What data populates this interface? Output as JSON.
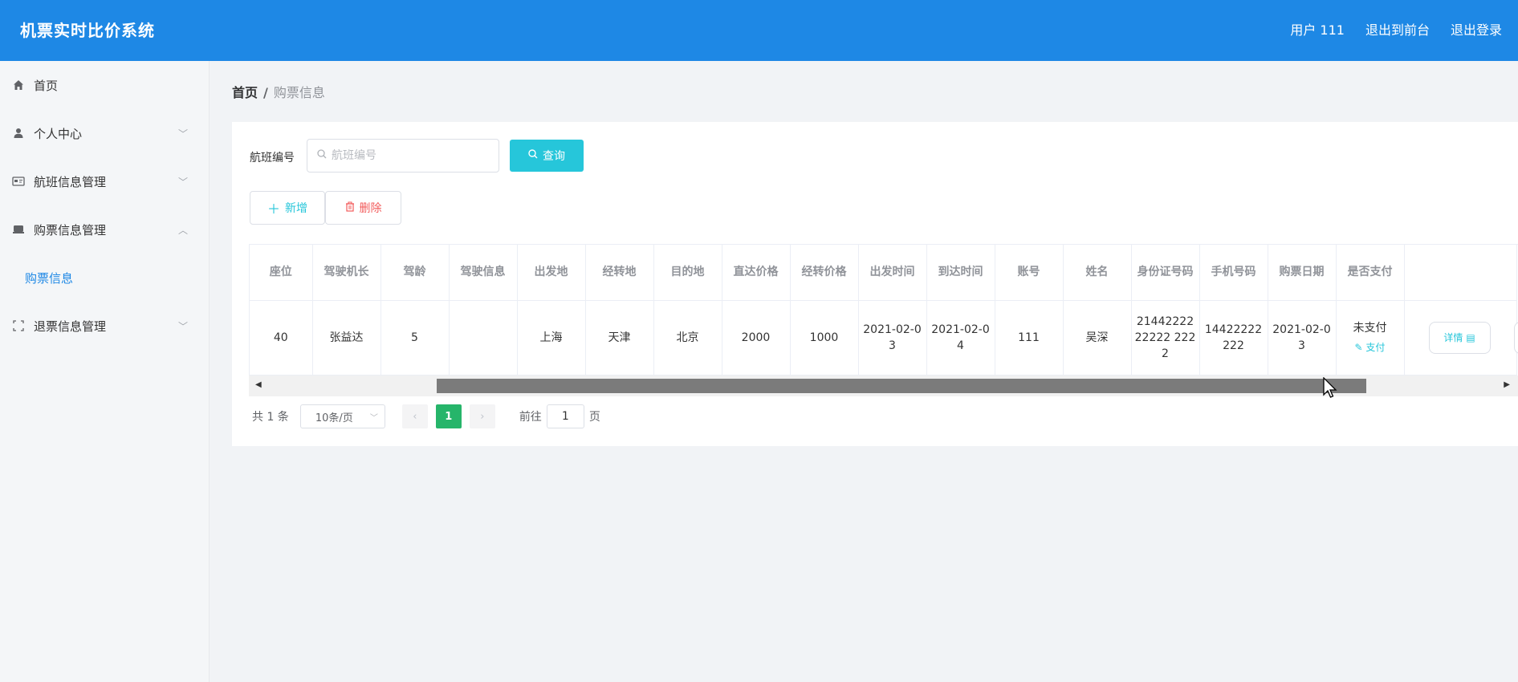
{
  "header": {
    "title": "机票实时比价系统",
    "user": "用户 111",
    "to_front": "退出到前台",
    "logout": "退出登录"
  },
  "sidebar": {
    "items": [
      {
        "label": "首页",
        "icon": "home-icon"
      },
      {
        "label": "个人中心",
        "icon": "user-icon"
      },
      {
        "label": "航班信息管理",
        "icon": "card-icon"
      },
      {
        "label": "购票信息管理",
        "icon": "ticket-icon",
        "expanded": true,
        "children": [
          {
            "label": "购票信息"
          }
        ]
      },
      {
        "label": "退票信息管理",
        "icon": "expand-icon"
      }
    ]
  },
  "breadcrumb": {
    "home": "首页",
    "sep": "/",
    "current": "购票信息"
  },
  "search": {
    "label": "航班编号",
    "placeholder": "航班编号",
    "query_label": "查询"
  },
  "actions": {
    "add_label": "新增",
    "delete_label": "删除"
  },
  "table": {
    "columns": [
      "座位",
      "驾驶机长",
      "驾龄",
      "驾驶信息",
      "出发地",
      "经转地",
      "目的地",
      "直达价格",
      "经转价格",
      "出发时间",
      "到达时间",
      "账号",
      "姓名",
      "身份证号码",
      "手机号码",
      "购票日期",
      "是否支付",
      ""
    ],
    "rows": [
      {
        "cells": [
          "40",
          "张益达",
          "5",
          "",
          "上海",
          "天津",
          "北京",
          "2000",
          "1000",
          "2021-02-03",
          "2021-02-04",
          "111",
          "吴深",
          "2144222222222 2222",
          "14422222222",
          "2021-02-03"
        ],
        "pay_status": "未支付",
        "pay_action": "支付",
        "detail_label": "详情"
      }
    ]
  },
  "pagination": {
    "total": "共 1 条",
    "page_size": "10条/页",
    "current_page": "1",
    "goto_label": "前往",
    "goto_value": "1",
    "page_unit": "页"
  },
  "colors": {
    "header_bg": "#1e88e5",
    "accent": "#26c6da",
    "danger": "#f25c5c",
    "page_active": "#26b56a"
  }
}
